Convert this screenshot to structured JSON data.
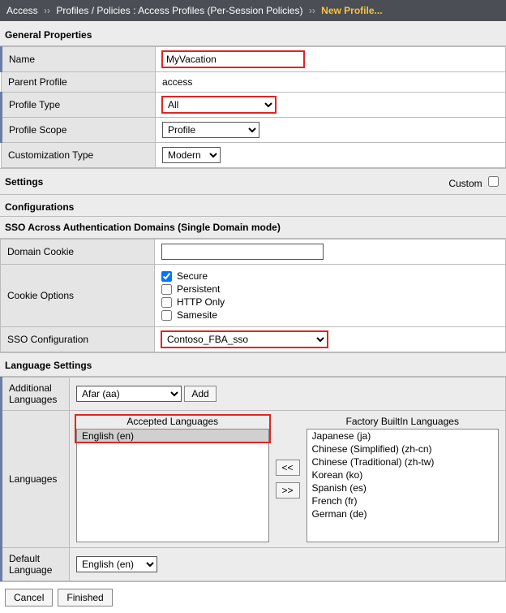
{
  "breadcrumb": {
    "part1": "Access",
    "sep": "››",
    "part2": "Profiles / Policies : Access Profiles (Per-Session Policies)",
    "current": "New Profile..."
  },
  "sections": {
    "general_properties": "General Properties",
    "settings": "Settings",
    "configurations": "Configurations",
    "sso_across": "SSO Across Authentication Domains (Single Domain mode)",
    "language_settings": "Language Settings"
  },
  "labels": {
    "name": "Name",
    "parent_profile": "Parent Profile",
    "profile_type": "Profile Type",
    "profile_scope": "Profile Scope",
    "customization_type": "Customization Type",
    "custom": "Custom",
    "domain_cookie": "Domain Cookie",
    "cookie_options": "Cookie Options",
    "sso_configuration": "SSO Configuration",
    "additional_languages": "Additional Languages",
    "languages": "Languages",
    "default_language": "Default Language",
    "accepted_languages": "Accepted Languages",
    "factory_languages": "Factory BuiltIn Languages",
    "add": "Add",
    "move_left": "<<",
    "move_right": ">>",
    "cancel": "Cancel",
    "finished": "Finished"
  },
  "values": {
    "name": "MyVacation",
    "parent_profile": "access",
    "profile_type": "All",
    "profile_scope": "Profile",
    "customization_type": "Modern",
    "domain_cookie": "",
    "sso_configuration": "Contoso_FBA_sso",
    "additional_language": "Afar (aa)",
    "default_language": "English (en)"
  },
  "cookie_options": {
    "secure": {
      "label": "Secure",
      "checked": true
    },
    "persistent": {
      "label": "Persistent",
      "checked": false
    },
    "http_only": {
      "label": "HTTP Only",
      "checked": false
    },
    "samesite": {
      "label": "Samesite",
      "checked": false
    }
  },
  "accepted_languages": [
    "English (en)"
  ],
  "factory_languages": [
    "Japanese (ja)",
    "Chinese (Simplified) (zh-cn)",
    "Chinese (Traditional) (zh-tw)",
    "Korean (ko)",
    "Spanish (es)",
    "French (fr)",
    "German (de)"
  ]
}
